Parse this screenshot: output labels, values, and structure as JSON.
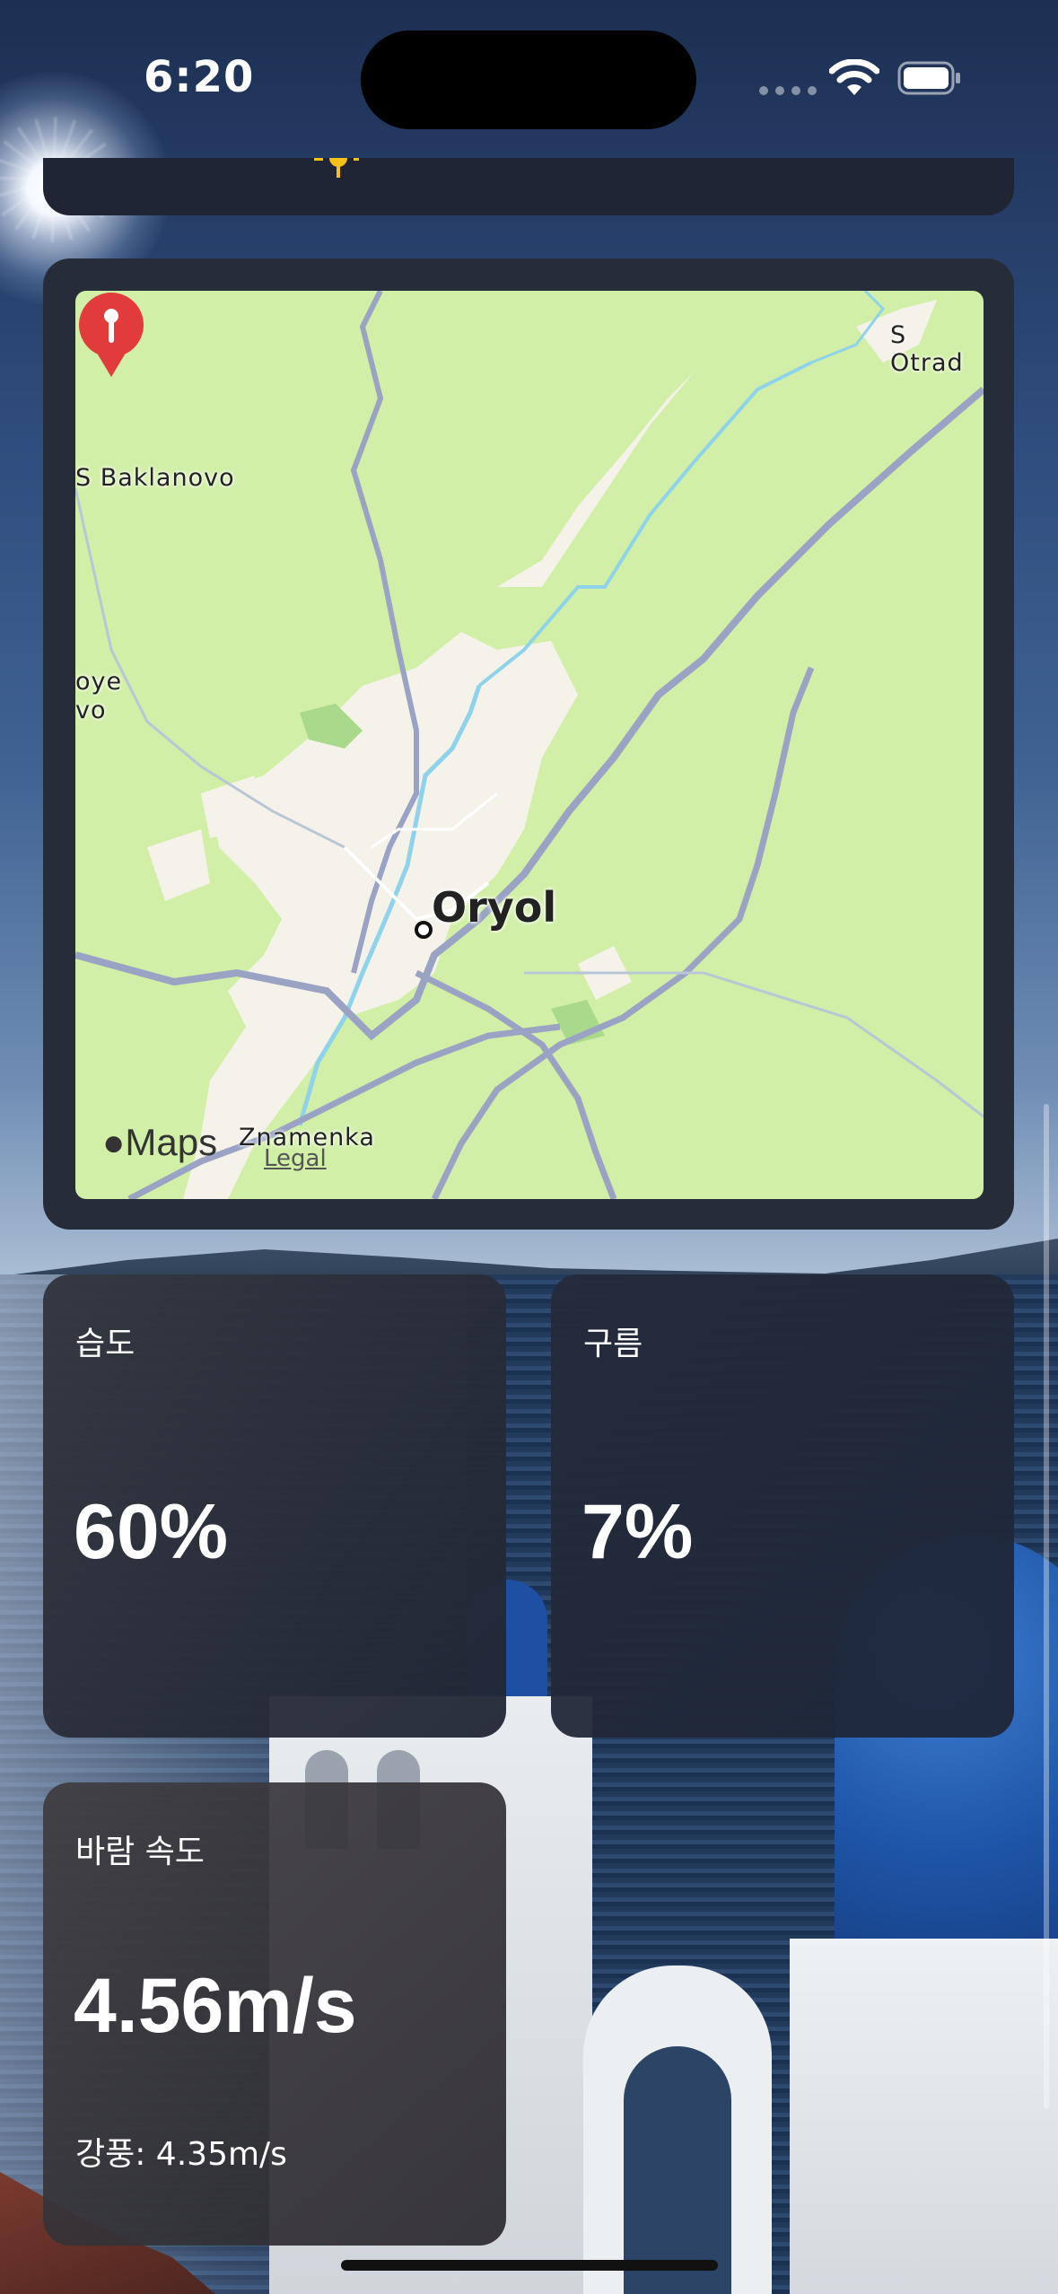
{
  "status_bar": {
    "time": "6:20",
    "icons": [
      "signal-dots-icon",
      "wifi-icon",
      "battery-icon"
    ]
  },
  "map": {
    "provider_logo": "Maps",
    "legal_label": "Legal",
    "city_label": "Oryol",
    "place_labels": {
      "baklanovo": "S Baklanovo",
      "otrada": "S Otrad",
      "znamenka": "Znamenka",
      "oye_line1": "oye",
      "oye_line2": "vo"
    },
    "pin_icon": "map-pin-icon"
  },
  "tiles": {
    "humidity": {
      "title": "습도",
      "value": "60%"
    },
    "clouds": {
      "title": "구름",
      "value": "7%"
    },
    "wind": {
      "title": "바람 속도",
      "value": "4.56m/s",
      "gust": "강풍: 4.35m/s"
    }
  },
  "colors": {
    "card_bg": "#262c38",
    "map_land": "#d1efa6",
    "map_road": "#9aa3c4",
    "pin_red": "#e23b3b"
  }
}
